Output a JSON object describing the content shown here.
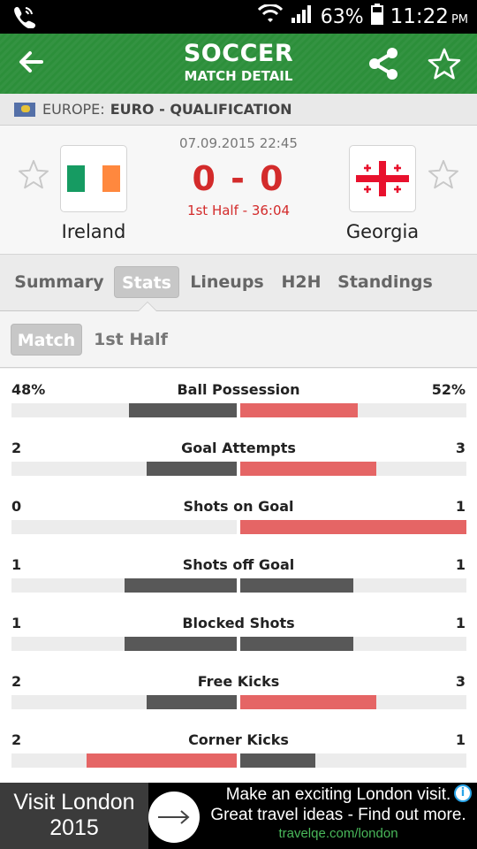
{
  "status_bar": {
    "battery": "63%",
    "time": "11:22",
    "ampm": "PM"
  },
  "header": {
    "title": "SOCCER",
    "subtitle": "MATCH DETAIL"
  },
  "league": {
    "region": "EUROPE:",
    "competition": "EURO - QUALIFICATION"
  },
  "match": {
    "datetime": "07.09.2015 22:45",
    "score": "0 - 0",
    "period": "1st Half - 36:04",
    "home": {
      "name": "Ireland"
    },
    "away": {
      "name": "Georgia"
    }
  },
  "tabs": [
    {
      "label": "Summary"
    },
    {
      "label": "Stats"
    },
    {
      "label": "Lineups"
    },
    {
      "label": "H2H"
    },
    {
      "label": "Standings"
    }
  ],
  "subtabs": [
    {
      "label": "Match"
    },
    {
      "label": "1st Half"
    }
  ],
  "stats": [
    {
      "name": "Ball Possession",
      "home": "48%",
      "away": "52%",
      "home_val": 48,
      "away_val": 52
    },
    {
      "name": "Goal Attempts",
      "home": "2",
      "away": "3",
      "home_val": 2,
      "away_val": 3
    },
    {
      "name": "Shots on Goal",
      "home": "0",
      "away": "1",
      "home_val": 0,
      "away_val": 1
    },
    {
      "name": "Shots off Goal",
      "home": "1",
      "away": "1",
      "home_val": 1,
      "away_val": 1
    },
    {
      "name": "Blocked Shots",
      "home": "1",
      "away": "1",
      "home_val": 1,
      "away_val": 1
    },
    {
      "name": "Free Kicks",
      "home": "2",
      "away": "3",
      "home_val": 2,
      "away_val": 3
    },
    {
      "name": "Corner Kicks",
      "home": "2",
      "away": "1",
      "home_val": 2,
      "away_val": 1
    }
  ],
  "ad": {
    "brand_line1": "Visit London",
    "brand_line2": "2015",
    "line1": "Make an exciting London visit.",
    "line2": "Great travel ideas - Find out more.",
    "url": "travelqe.com/london",
    "info": "i"
  },
  "colors": {
    "header_green": "#2c8f3a",
    "score_red": "#d32b2b",
    "bar_dark": "#585858",
    "bar_red": "#e56565"
  }
}
